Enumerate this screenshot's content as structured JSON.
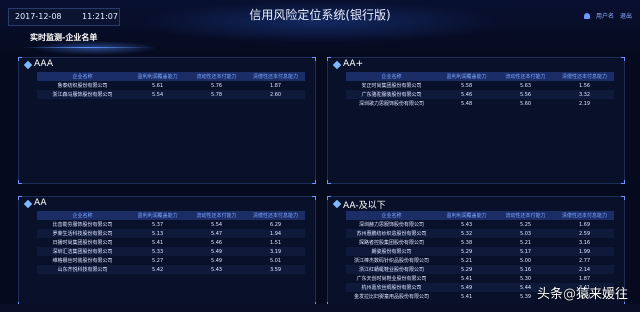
{
  "header": {
    "date": "2017-12-08",
    "time": "11:21:07",
    "title": "信用风险定位系统(银行版)",
    "user_label": "用户名",
    "logout_label": "退出"
  },
  "section": {
    "title": "实时监测-企业名单"
  },
  "columns": [
    "企业名称",
    "盈利利润覆盖能力",
    "流动性还本付能力",
    "清偿性还本付息能力"
  ],
  "panels": [
    {
      "title": "AAA",
      "rows": [
        [
          "鲁泰纺织股份有限公司",
          "5.61",
          "5.76",
          "1.87"
        ],
        [
          "浙江森马服饰股份有限公司",
          "5.54",
          "5.78",
          "2.60"
        ]
      ]
    },
    {
      "title": "AA+",
      "rows": [
        [
          "安正时尚集团股份有限公司",
          "5.58",
          "5.63",
          "1.56"
        ],
        [
          "广东骆驼服装股份有限公司",
          "5.46",
          "5.56",
          "3.32"
        ],
        [
          "深圳歌力思服饰股份有限公司",
          "5.48",
          "5.60",
          "2.19"
        ]
      ]
    },
    {
      "title": "AA",
      "rows": [
        [
          "比音勒芬服饰股份有限公司",
          "5.37",
          "5.54",
          "6.29"
        ],
        [
          "罗莱生活科技股份有限公司",
          "5.13",
          "5.47",
          "1.94"
        ],
        [
          "日播时尚集团股份有限公司",
          "5.41",
          "5.46",
          "1.51"
        ],
        [
          "深圳汇洁集团股份有限公司",
          "5.33",
          "5.49",
          "3.19"
        ],
        [
          "维格娜丝时装股份有限公司",
          "5.27",
          "5.49",
          "5.01"
        ],
        [
          "山东齐悦科技有限公司",
          "5.42",
          "5.43",
          "3.59"
        ]
      ]
    },
    {
      "title": "AA-及以下",
      "rows": [
        [
          "深圳赫力思服饰股份有限公司",
          "5.43",
          "5.25",
          "1.69"
        ],
        [
          "苏州惠鹏纺纱织造股份有限公司",
          "5.32",
          "5.03",
          "2.59"
        ],
        [
          "探路者控股集团股份有限公司",
          "5.38",
          "5.21",
          "3.16"
        ],
        [
          "朗姿股份有限公司",
          "5.29",
          "5.17",
          "1.99"
        ],
        [
          "浙江棒杰数码针织品股份有限公司",
          "5.21",
          "5.00",
          "2.77"
        ],
        [
          "浙江红蜻蜓鞋业股份有限公司",
          "5.29",
          "5.16",
          "2.14"
        ],
        [
          "广东天创时尚鞋业股份有限公司",
          "5.41",
          "5.30",
          "1.87"
        ],
        [
          "杭州嘉欣丝绸股份有限公司",
          "5.49",
          "5.44",
          "3.41"
        ],
        [
          "金发拉比妇婴童用品股份有限公司",
          "5.41",
          "5.39",
          "5.49"
        ]
      ]
    }
  ],
  "watermark": {
    "brand": "头条",
    "at": "@",
    "author": "猿来媛往"
  }
}
